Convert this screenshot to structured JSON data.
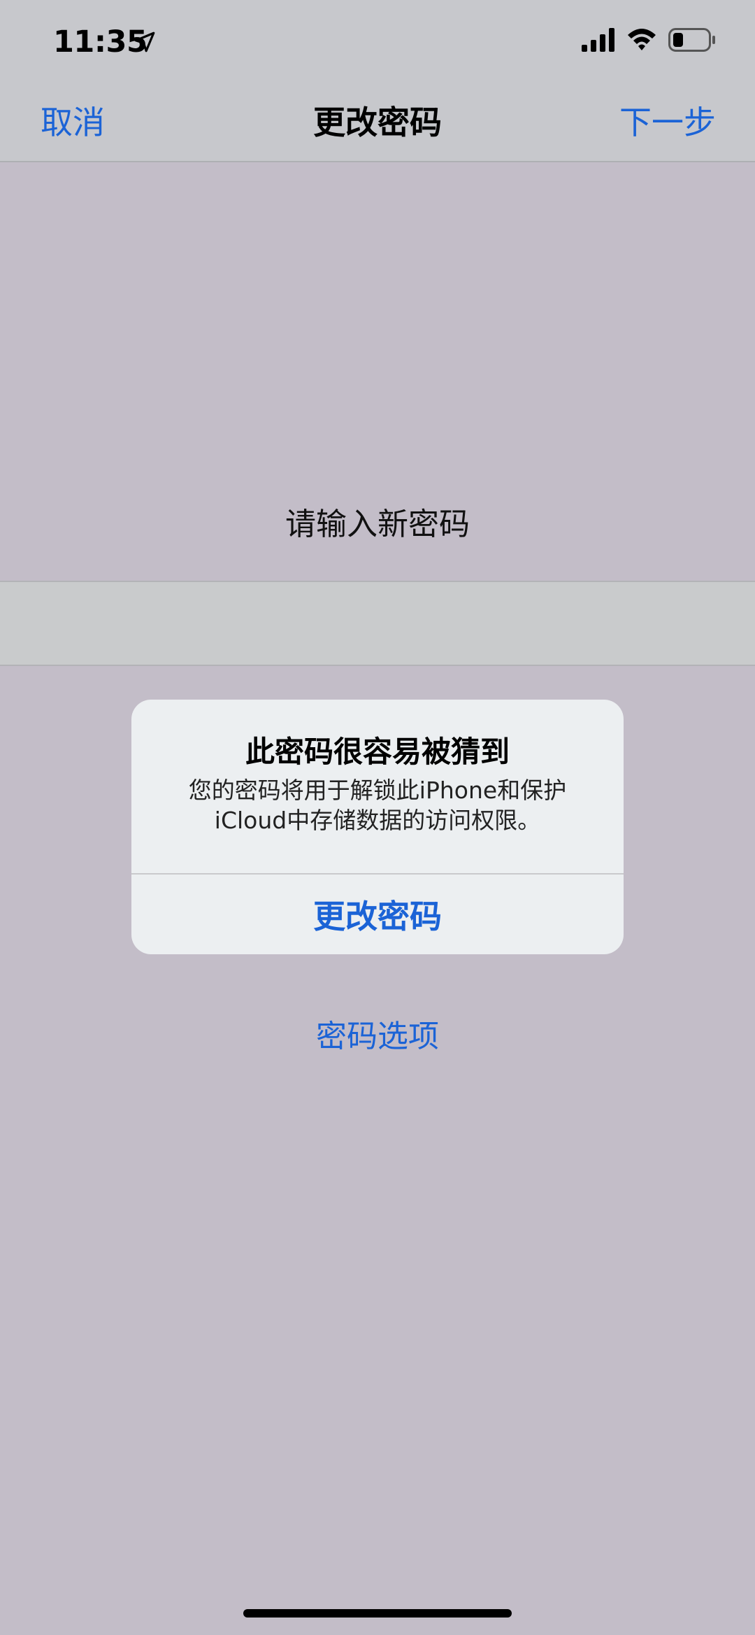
{
  "status_bar": {
    "time": "11:35",
    "icons": [
      "location-arrow-icon",
      "cellular-signal-icon",
      "wifi-icon",
      "battery-icon"
    ]
  },
  "nav": {
    "cancel_label": "取消",
    "title": "更改密码",
    "next_label": "下一步"
  },
  "prompt": "请输入新密码",
  "alert": {
    "title": "此密码很容易被猜到",
    "message": "您的密码将用于解锁此iPhone和保护iCloud中存储数据的访问权限。",
    "button_label": "更改密码"
  },
  "options_link": "密码选项",
  "colors": {
    "accent": "#1b63d6",
    "background": "#c3bdc8",
    "bar": "#c7c8cc",
    "alert": "#eceff1"
  }
}
